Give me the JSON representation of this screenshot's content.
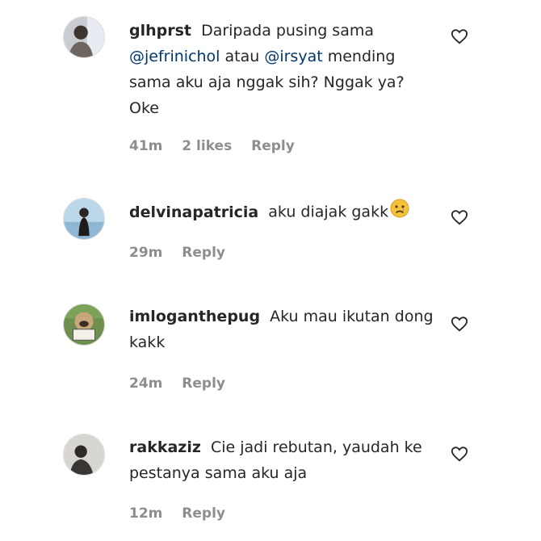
{
  "comments": [
    {
      "username": "glhprst",
      "text_before": "Daripada pusing sama",
      "mention1": "@jefrinichol",
      "text_middle": "atau",
      "mention2": "@irsyat",
      "text_after": "mending sama aku aja nggak sih? Nggak ya? Oke",
      "time": "41m",
      "likes": "2 likes",
      "reply": "Reply"
    },
    {
      "username": "delvinapatricia",
      "text": "aku diajak gakk",
      "emoji": "sad-face-emoji",
      "time": "29m",
      "reply": "Reply"
    },
    {
      "username": "imloganthepug",
      "text": "Aku mau ikutan dong kakk",
      "time": "24m",
      "reply": "Reply"
    },
    {
      "username": "rakkaziz",
      "text": "Cie jadi rebutan, yaudah ke pestanya sama aku aja",
      "time": "12m",
      "reply": "Reply"
    }
  ],
  "icons": {
    "like": "heart-outline-icon"
  },
  "colors": {
    "text": "#262626",
    "meta": "#8e8e8e",
    "mention": "#00376b"
  }
}
